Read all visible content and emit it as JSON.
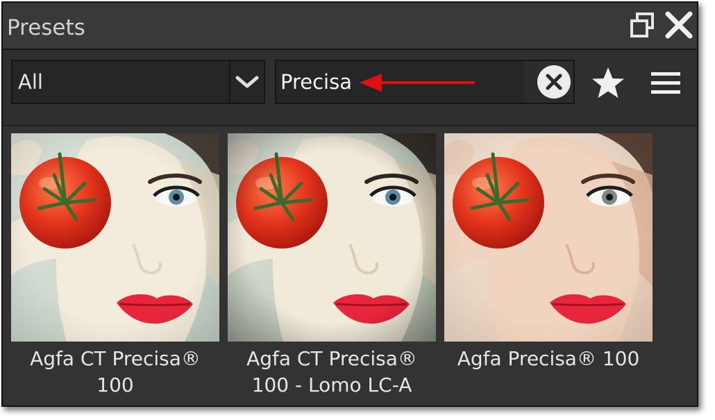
{
  "panel": {
    "title": "Presets",
    "restore_icon": "restore-window-icon",
    "close_icon": "close-icon"
  },
  "toolbar": {
    "filter": {
      "value": "All",
      "icon": "chevron-down-icon"
    },
    "search": {
      "value": "Precisa",
      "clear_icon": "clear-circle-x-icon"
    },
    "favorites_icon": "star-icon",
    "menu_icon": "hamburger-menu-icon",
    "annotation_arrow_color": "#e01010"
  },
  "presets": [
    {
      "line1": "Agfa CT Precisa®",
      "line2": "100",
      "tone": "cool"
    },
    {
      "line1": "Agfa CT Precisa®",
      "line2": "100 - Lomo LC-A",
      "tone": "cool-vignette"
    },
    {
      "line1": "Agfa Precisa® 100",
      "line2": "",
      "tone": "warm"
    }
  ],
  "colors": {
    "panel_bg": "#333333",
    "title_text": "#d2d2d2",
    "accent_red": "#e01010"
  }
}
